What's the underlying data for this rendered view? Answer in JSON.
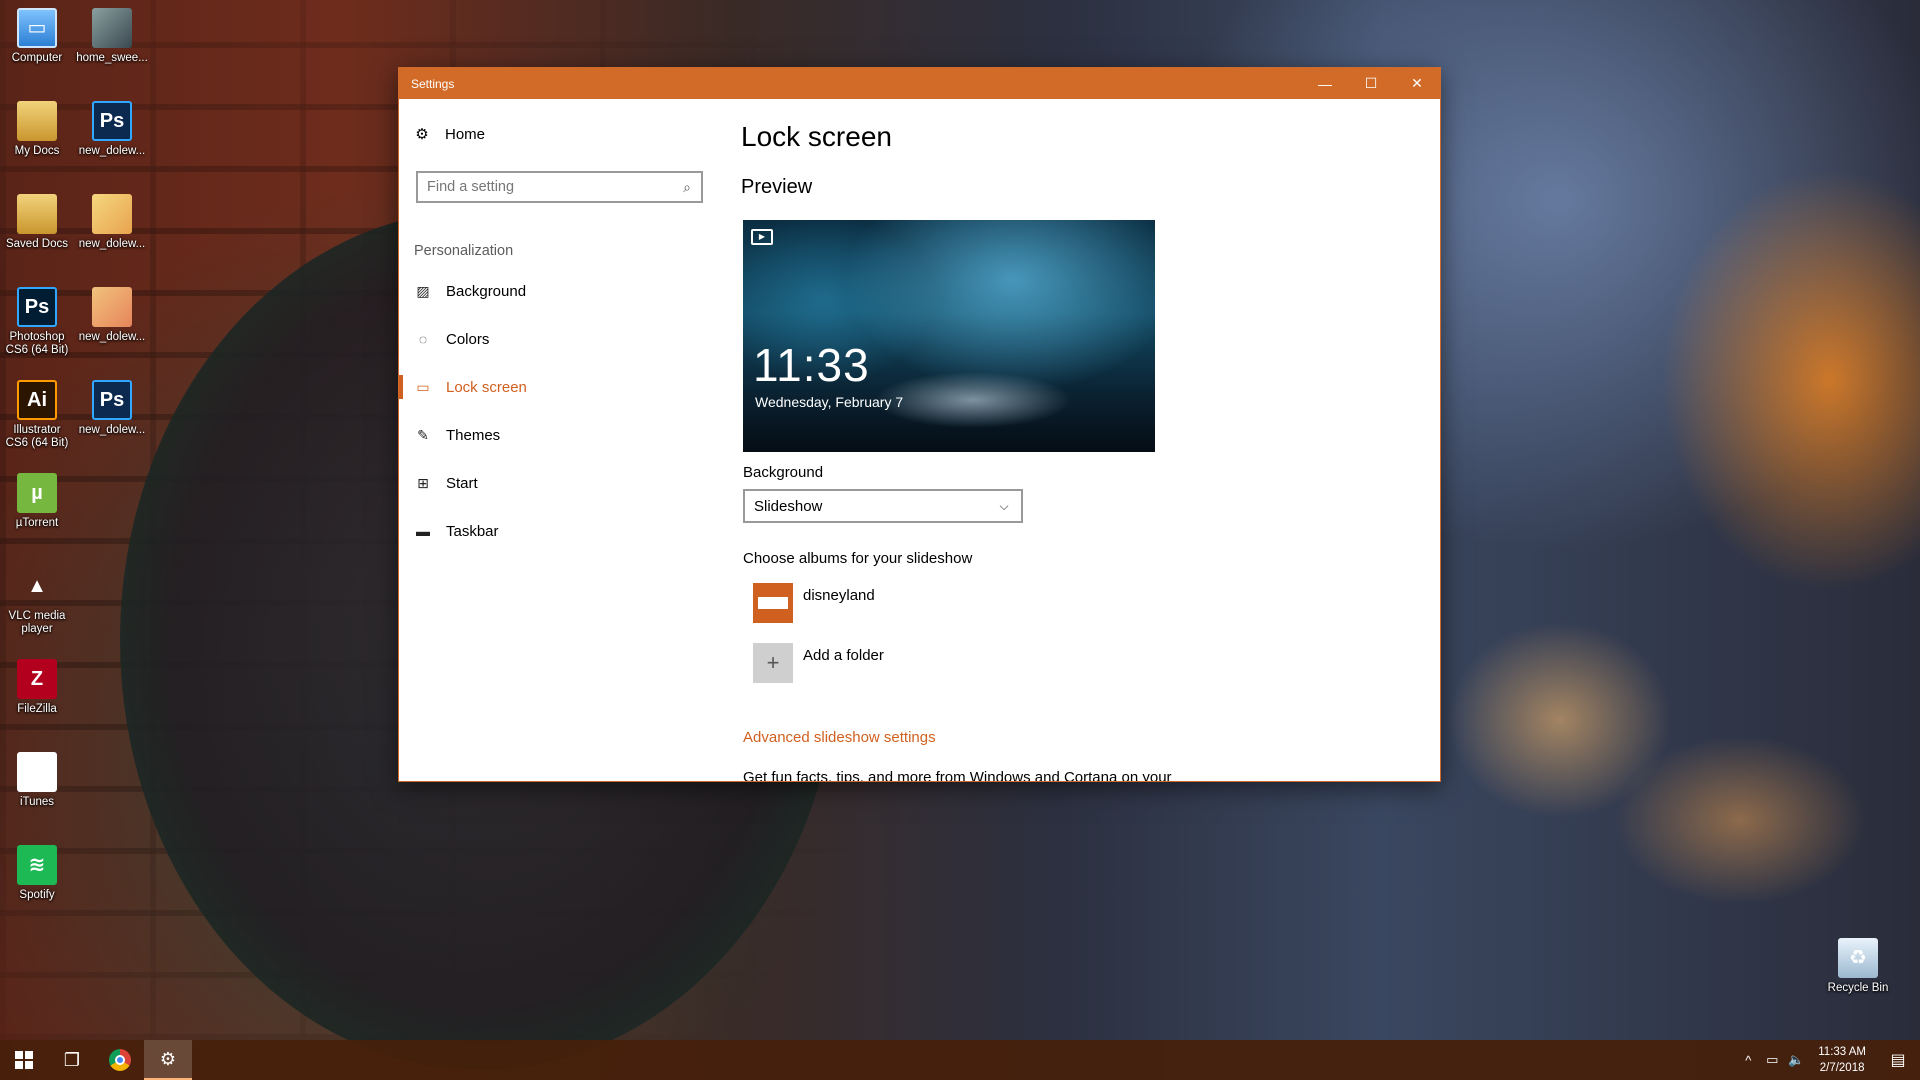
{
  "desktop": {
    "icons": [
      {
        "label": "Computer",
        "glyph": "▭"
      },
      {
        "label": "home_swee...",
        "glyph": ""
      },
      {
        "label": "My Docs",
        "glyph": ""
      },
      {
        "label": "new_dolew...",
        "glyph": "Ps"
      },
      {
        "label": "Saved Docs",
        "glyph": ""
      },
      {
        "label": "new_dolew...",
        "glyph": ""
      },
      {
        "label": "Photoshop CS6 (64 Bit)",
        "glyph": "Ps"
      },
      {
        "label": "new_dolew...",
        "glyph": ""
      },
      {
        "label": "Illustrator CS6 (64 Bit)",
        "glyph": "Ai"
      },
      {
        "label": "new_dolew...",
        "glyph": "Ps"
      },
      {
        "label": "µTorrent",
        "glyph": "µ"
      },
      {
        "label": "VLC media player",
        "glyph": "▲"
      },
      {
        "label": "FileZilla",
        "glyph": "Z"
      },
      {
        "label": "iTunes",
        "glyph": "♫"
      },
      {
        "label": "Spotify",
        "glyph": "≋"
      },
      {
        "label": "Recycle Bin",
        "glyph": "♻"
      }
    ]
  },
  "window": {
    "title": "Settings",
    "controls": {
      "minimize": "—",
      "maximize": "☐",
      "close": "✕"
    }
  },
  "nav": {
    "home": {
      "label": "Home",
      "icon": "gear-icon",
      "glyph": "⚙"
    },
    "search": {
      "placeholder": "Find a setting",
      "icon": "⌕"
    },
    "section": "Personalization",
    "items": [
      {
        "label": "Background",
        "icon": "picture-icon",
        "glyph": "▨"
      },
      {
        "label": "Colors",
        "icon": "palette-icon",
        "glyph": "◌"
      },
      {
        "label": "Lock screen",
        "icon": "lock-screen-icon",
        "glyph": "▭"
      },
      {
        "label": "Themes",
        "icon": "brush-icon",
        "glyph": "✎"
      },
      {
        "label": "Start",
        "icon": "start-icon",
        "glyph": "⊞"
      },
      {
        "label": "Taskbar",
        "icon": "taskbar-icon",
        "glyph": "▬"
      }
    ],
    "active": "Lock screen"
  },
  "main": {
    "title": "Lock screen",
    "preview_title": "Preview",
    "preview": {
      "time": "11:33",
      "date": "Wednesday, February 7",
      "icon": "▶"
    },
    "background_label": "Background",
    "background_value": "Slideshow",
    "chevron": "⌵",
    "albums_label": "Choose albums for your slideshow",
    "albums": [
      {
        "label": "disneyland"
      }
    ],
    "add_folder": {
      "label": "Add a folder",
      "glyph": "+"
    },
    "advanced_link": "Advanced slideshow settings",
    "clipped_text": "Get fun facts, tips, and more from Windows and Cortana on your"
  },
  "taskbar": {
    "task_view_glyph": "❐",
    "settings_glyph": "⚙",
    "tray": {
      "chevron": "^",
      "network": "▭",
      "volume": "🔈"
    },
    "time": "11:33 AM",
    "date": "2/7/2018",
    "notification_glyph": "▤"
  },
  "colors": {
    "accent": "#d0601f",
    "titlebar": "#d26b28"
  }
}
